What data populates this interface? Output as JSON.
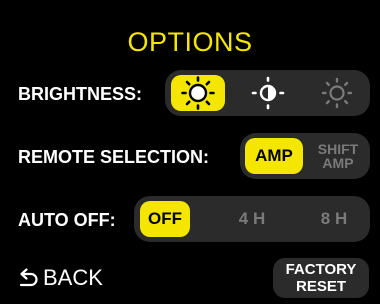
{
  "title": "OPTIONS",
  "brightness": {
    "label": "BRIGHTNESS:",
    "options": [
      {
        "icon": "sun-bright-icon",
        "active": true
      },
      {
        "icon": "sun-half-icon",
        "active": false
      },
      {
        "icon": "sun-dim-icon",
        "active": false
      }
    ]
  },
  "remote": {
    "label": "REMOTE SELECTION:",
    "options": [
      {
        "label": "AMP",
        "active": true
      },
      {
        "line1": "SHIFT",
        "line2": "AMP",
        "active": false
      }
    ]
  },
  "auto_off": {
    "label": "AUTO OFF:",
    "options": [
      {
        "label": "OFF",
        "active": true
      },
      {
        "label": "4 H",
        "active": false
      },
      {
        "label": "8 H",
        "active": false
      }
    ]
  },
  "back": {
    "label": "BACK",
    "icon": "back-arrow-icon"
  },
  "factory_reset": {
    "line1": "FACTORY",
    "line2": "RESET"
  },
  "colors": {
    "accent": "#f5e600",
    "segment_bg": "#2b2b2b",
    "inactive_text": "#7a7a7a"
  }
}
